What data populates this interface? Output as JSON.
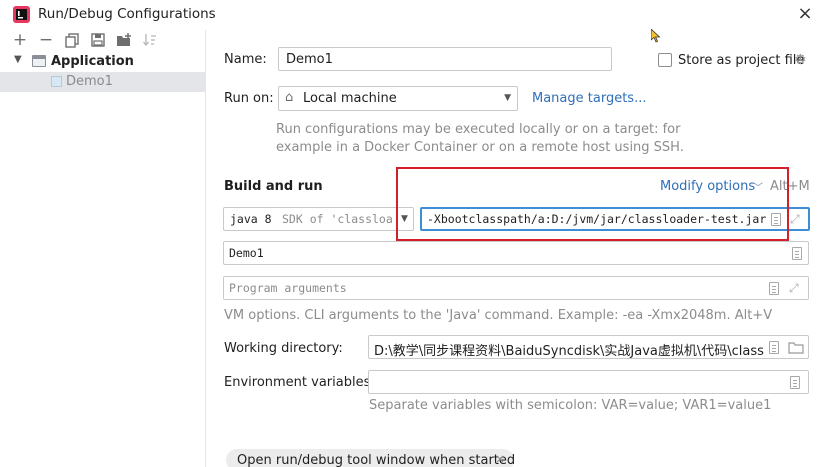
{
  "window": {
    "title": "Run/Debug Configurations",
    "close_icon": "×"
  },
  "toolbar": {
    "add": "+",
    "remove": "−"
  },
  "tree": {
    "group": "Application",
    "item": "Demo1"
  },
  "name": {
    "label": "Name:",
    "value": "Demo1"
  },
  "store": {
    "label": "Store as project file"
  },
  "run_on": {
    "label": "Run on:",
    "value": "Local machine",
    "manage": "Manage targets..."
  },
  "run_info": {
    "line1": "Run configurations may be executed locally or on a target: for",
    "line2": "example in a Docker Container or on a remote host using SSH."
  },
  "build": {
    "heading": "Build and run",
    "modify": "Modify options",
    "shortcut": "Alt+M"
  },
  "jdk": {
    "bold": "java 8",
    "rest": "SDK of 'classloader"
  },
  "vm_options": {
    "value": "-Xbootclasspath/a:D:/jvm/jar/classloader-test.jar"
  },
  "main_class": {
    "value": "Demo1"
  },
  "program_args": {
    "placeholder": "Program arguments"
  },
  "vm_hint": "VM options. CLI arguments to the 'Java' command. Example: -ea -Xmx2048m. Alt+V",
  "working_dir": {
    "label": "Working directory:",
    "value": "D:\\教学\\同步课程资料\\BaiduSyncdisk\\实战Java虚拟机\\代码\\classloader"
  },
  "env": {
    "label": "Environment variables:",
    "hint": "Separate variables with semicolon: VAR=value; VAR1=value1"
  },
  "open_tool": {
    "label": "Open run/debug tool window when started",
    "remove": "×"
  },
  "colors": {
    "highlight_border": "#d2202a",
    "link": "#2f6fb8",
    "focus": "#3d8ed6"
  }
}
